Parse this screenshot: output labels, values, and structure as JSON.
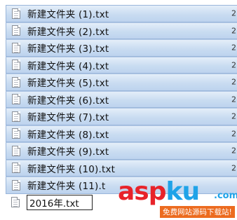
{
  "files": [
    {
      "name": "新建文件夹 (1).txt",
      "col": "2",
      "selected": true
    },
    {
      "name": "新建文件夹 (2).txt",
      "col": "2",
      "selected": true
    },
    {
      "name": "新建文件夹 (3).txt",
      "col": "2",
      "selected": true
    },
    {
      "name": "新建文件夹 (4).txt",
      "col": "2",
      "selected": true
    },
    {
      "name": "新建文件夹 (5).txt",
      "col": "2",
      "selected": true
    },
    {
      "name": "新建文件夹 (6).txt",
      "col": "2",
      "selected": true
    },
    {
      "name": "新建文件夹 (7).txt",
      "col": "2",
      "selected": true
    },
    {
      "name": "新建文件夹 (8).txt",
      "col": "2",
      "selected": true
    },
    {
      "name": "新建文件夹 (9).txt",
      "col": "2",
      "selected": true
    },
    {
      "name": "新建文件夹 (10).txt",
      "col": "2",
      "selected": true
    },
    {
      "name": "新建文件夹 (11).t",
      "col": "",
      "selected": true
    }
  ],
  "rename": {
    "value": "2016年.txt"
  },
  "icons": {
    "file": "text-file-icon"
  },
  "watermark": {
    "asp": "asp",
    "ku": "ku",
    "com": ".com",
    "slogan": "免费网站源码下载站!"
  },
  "colors": {
    "selection": "#c9dcf1",
    "selection_border": "#9ab6da",
    "watermark_red": "#e8232a",
    "watermark_blue": "#1fa3e8",
    "watermark_orange": "#ec6b1f"
  }
}
